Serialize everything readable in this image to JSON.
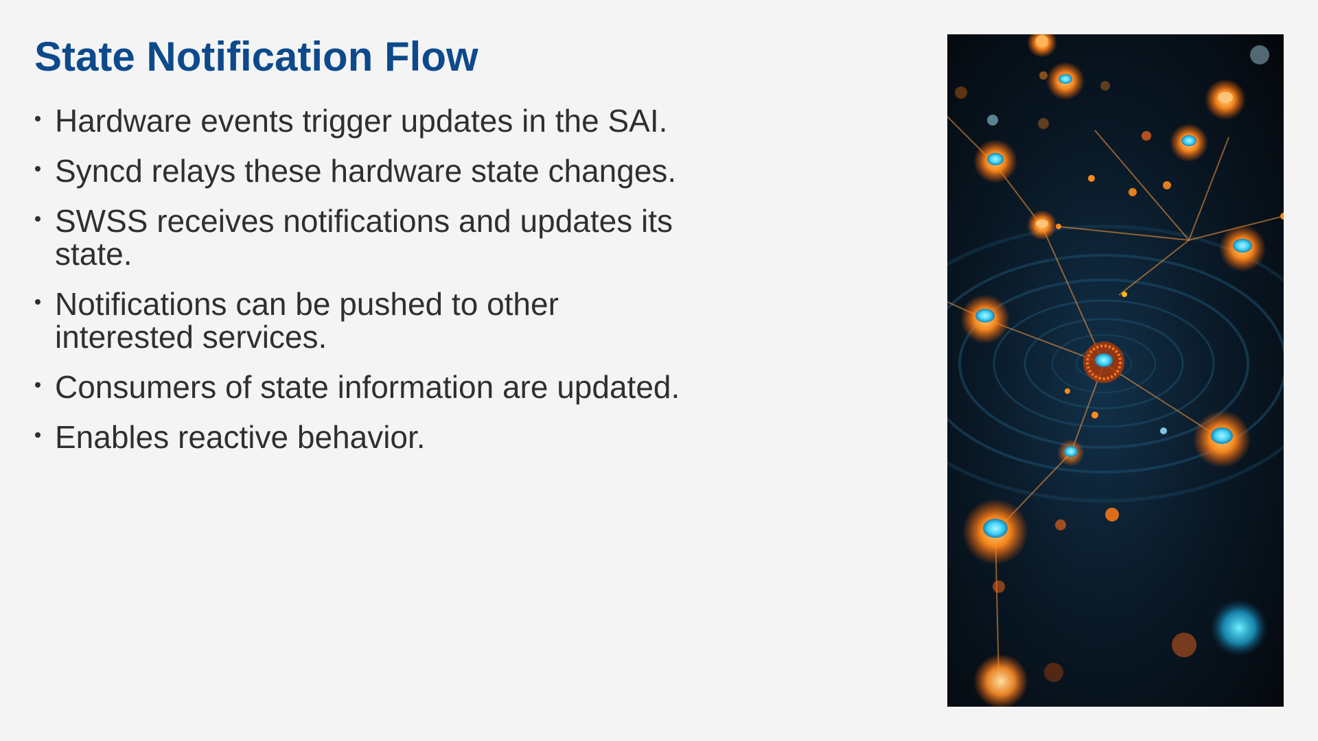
{
  "slide": {
    "title": "State Notification Flow",
    "bullets": [
      "Hardware events trigger updates in the SAI.",
      "Syncd relays these hardware state changes.",
      "SWSS receives notifications and updates its state.",
      "Notifications can be pushed to other interested services.",
      "Consumers of state information are updated.",
      "Enables reactive behavior."
    ],
    "image": {
      "name": "network-nodes-illustration",
      "description_icon": "network-graph-image"
    }
  },
  "colors": {
    "background": "#f4f4f4",
    "title": "#0d4a8c",
    "body_text": "#2f2f2f",
    "node_orange": "#ff8a1c",
    "node_cyan": "#3fd2f5",
    "image_bg": "#0a1a28"
  }
}
